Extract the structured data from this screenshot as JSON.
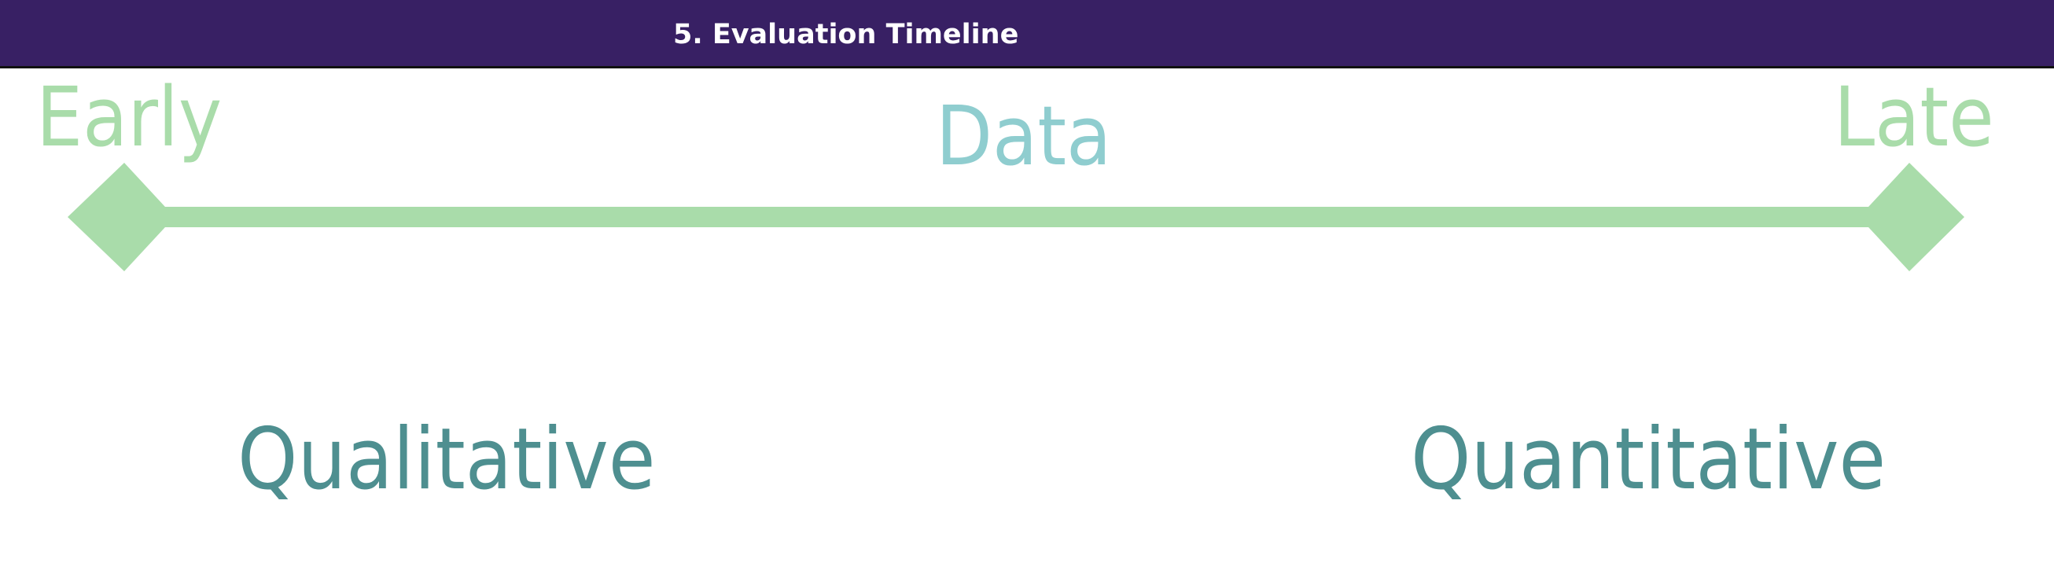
{
  "header": {
    "title": "5. Evaluation Timeline"
  },
  "timeline": {
    "start_label": "Early",
    "end_label": "Late",
    "center_label": "Data",
    "left_category": "Qualitative",
    "right_category": "Quantitative"
  },
  "colors": {
    "header_bg": "#382064",
    "timeline_green": "#a9dcaa",
    "data_teal": "#8fcdcf",
    "category_teal": "#4e8f90"
  }
}
